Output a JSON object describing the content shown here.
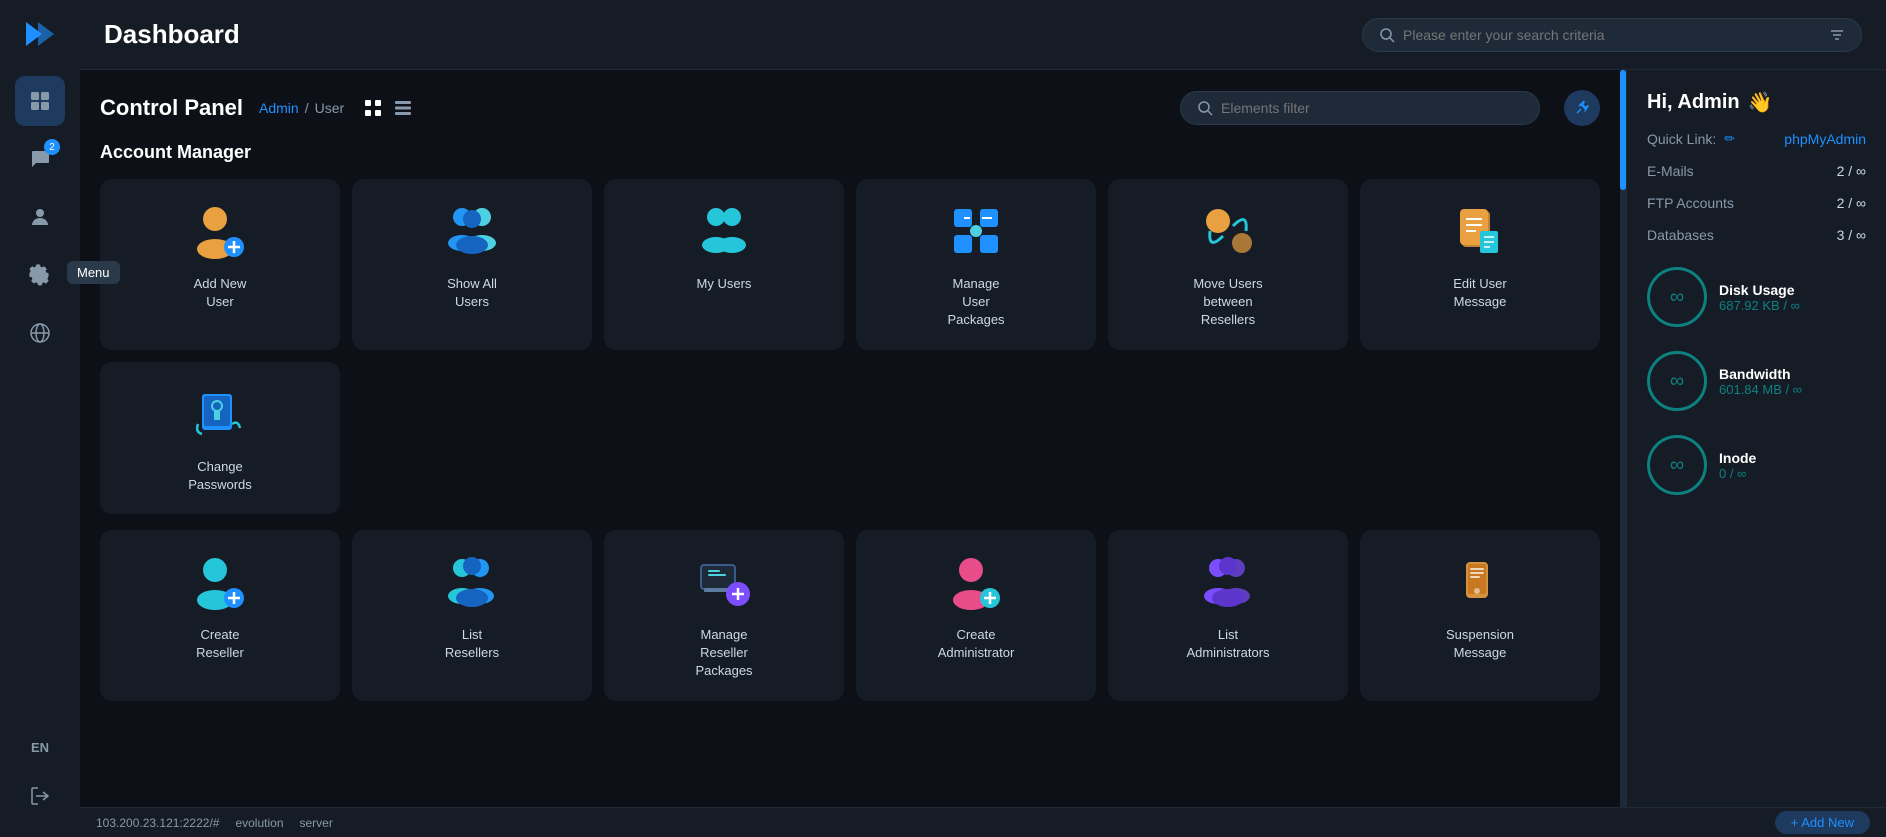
{
  "app": {
    "title": "Dashboard",
    "logo": "▶▶"
  },
  "sidebar": {
    "items": [
      {
        "id": "grid",
        "icon": "⊞",
        "active": true,
        "badge": null
      },
      {
        "id": "chat",
        "icon": "💬",
        "active": false,
        "badge": "2"
      },
      {
        "id": "user",
        "icon": "👤",
        "active": false,
        "badge": null
      },
      {
        "id": "settings",
        "icon": "⚙",
        "active": false,
        "badge": null
      },
      {
        "id": "globe",
        "icon": "🌐",
        "active": false,
        "badge": null
      }
    ],
    "lang": "EN",
    "logout_icon": "→",
    "menu_tooltip": "Menu"
  },
  "topbar": {
    "search_placeholder": "Please enter your search criteria"
  },
  "control_panel": {
    "title": "Control Panel",
    "breadcrumb": {
      "admin": "Admin",
      "separator": "/",
      "current": "User"
    },
    "filter_placeholder": "Elements filter",
    "view_modes": [
      "grid",
      "list"
    ]
  },
  "account_manager": {
    "title": "Account Manager",
    "cards_row1": [
      {
        "id": "add-new-user",
        "label": "Add New\nUser",
        "icon_type": "add-user"
      },
      {
        "id": "show-all-users",
        "label": "Show All\nUsers",
        "icon_type": "show-users"
      },
      {
        "id": "my-users",
        "label": "My Users",
        "icon_type": "my-users"
      },
      {
        "id": "manage-user-packages",
        "label": "Manage\nUser\nPackages",
        "icon_type": "manage-packages"
      },
      {
        "id": "move-users",
        "label": "Move Users\nbetween\nResellers",
        "icon_type": "move-users"
      },
      {
        "id": "edit-user-message",
        "label": "Edit User\nMessage",
        "icon_type": "edit-message"
      },
      {
        "id": "change-passwords",
        "label": "Change\nPasswords",
        "icon_type": "change-passwords"
      }
    ],
    "cards_row2": [
      {
        "id": "create-reseller",
        "label": "Create\nReseller",
        "icon_type": "create-reseller"
      },
      {
        "id": "list-resellers",
        "label": "List\nResellers",
        "icon_type": "list-resellers"
      },
      {
        "id": "manage-reseller-packages",
        "label": "Manage\nReseller\nPackages",
        "icon_type": "manage-reseller-packages"
      },
      {
        "id": "create-administrator",
        "label": "Create\nAdministrator",
        "icon_type": "create-admin"
      },
      {
        "id": "list-administrators",
        "label": "List\nAdministrators",
        "icon_type": "list-admins"
      },
      {
        "id": "suspension-message",
        "label": "Suspension\nMessage",
        "icon_type": "suspension-message"
      }
    ]
  },
  "right_sidebar": {
    "greeting": "Hi, Admin",
    "greeting_emoji": "👋",
    "quick_link_label": "Quick Link:",
    "quick_link_value": "phpMyAdmin",
    "stats": [
      {
        "label": "E-Mails",
        "value": "2 / ∞"
      },
      {
        "label": "FTP Accounts",
        "value": "2 / ∞"
      },
      {
        "label": "Databases",
        "value": "3 / ∞"
      }
    ],
    "usage": [
      {
        "id": "disk",
        "title": "Disk Usage",
        "value": "687.92 KB",
        "separator": "/",
        "limit": "∞"
      },
      {
        "id": "bandwidth",
        "title": "Bandwidth",
        "value": "601.84 MB",
        "separator": "/",
        "limit": "∞"
      },
      {
        "id": "inode",
        "title": "Inode",
        "value": "0",
        "separator": "/",
        "limit": "∞"
      }
    ]
  },
  "bottom_bar": {
    "server_ip": "103.200.23.121:2222/#",
    "server_name": "evolution",
    "server_label": "server",
    "add_new_label": "+ Add New"
  }
}
